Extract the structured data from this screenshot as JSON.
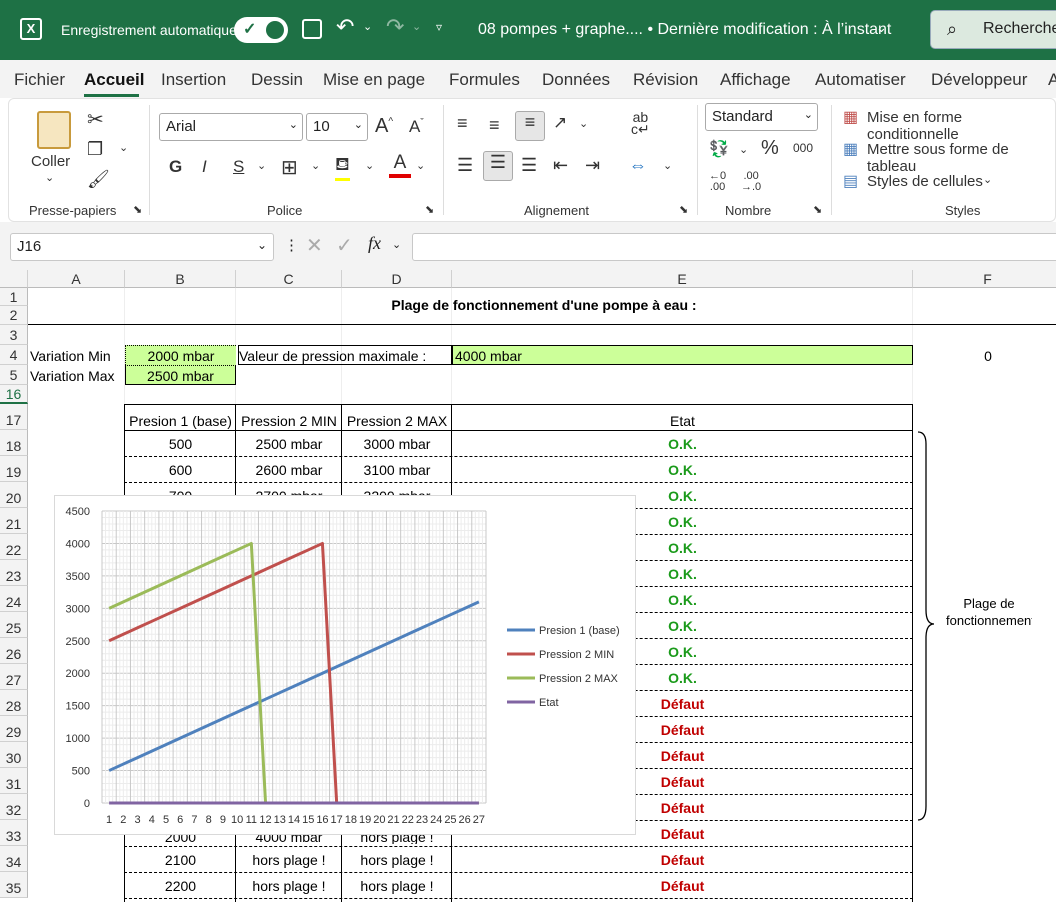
{
  "titlebar": {
    "autosave_label": "Enregistrement automatique",
    "doc_title": "08 pompes + graphe.... • Dernière modification : À l’instant",
    "search_label": "Recherche"
  },
  "menu": [
    "Fichier",
    "Accueil",
    "Insertion",
    "Dessin",
    "Mise en page",
    "Formules",
    "Données",
    "Révision",
    "Affichage",
    "Automatiser",
    "Développeur",
    "A"
  ],
  "ribbon": {
    "clipboard": {
      "paste_label": "Coller",
      "group": "Presse-papiers"
    },
    "font": {
      "name": "Arial",
      "size": "10",
      "bold": "G",
      "italic": "I",
      "underline": "S",
      "group": "Police"
    },
    "alignment": {
      "group": "Alignement"
    },
    "number": {
      "format": "Standard",
      "percent": "%",
      "thousands": "000",
      "group": "Nombre"
    },
    "styles": {
      "conditional": "Mise en forme conditionnelle",
      "table": "Mettre sous forme de tableau",
      "cell_styles": "Styles de cellules",
      "group": "Styles"
    }
  },
  "formula": {
    "name_box": "J16",
    "fx": "fx"
  },
  "columns": [
    "A",
    "B",
    "C",
    "D",
    "E",
    "F"
  ],
  "rows": [
    "1",
    "2",
    "3",
    "4",
    "5",
    "16",
    "17",
    "18",
    "19",
    "20",
    "21",
    "22",
    "23",
    "24",
    "25",
    "26",
    "27",
    "28",
    "29",
    "30",
    "31",
    "32",
    "33",
    "34",
    "35"
  ],
  "sheet": {
    "title": "Plage de fonctionnement d'une pompe à eau :",
    "var_min_label": "Variation Min",
    "var_min_value": "2000 mbar",
    "var_max_label": "Variation Max",
    "var_max_value": "2500 mbar",
    "max_pressure_label": "Valeur de pression maximale :",
    "max_pressure_value": "4000 mbar",
    "f4_value": "0",
    "table_headers": [
      "Presion 1 (base)",
      "Pression 2 MIN",
      "Pression 2 MAX",
      "Etat"
    ],
    "row18": [
      "500",
      "2500 mbar",
      "3000 mbar",
      "O.K."
    ],
    "row19": [
      "600",
      "2600 mbar",
      "3100 mbar",
      "O.K."
    ],
    "row20_partial": [
      "700",
      "2700 mbar",
      "3200 mbar"
    ],
    "row33_partial": [
      "2000",
      "4000 mbar",
      "hors plage !"
    ],
    "row34": [
      "2100",
      "hors plage !",
      "hors plage !",
      "Défaut"
    ],
    "row35": [
      "2200",
      "hors plage !",
      "hors plage !",
      "Défaut"
    ],
    "etat_column": [
      "O.K.",
      "O.K.",
      "O.K.",
      "O.K.",
      "O.K.",
      "O.K.",
      "O.K.",
      "O.K.",
      "O.K.",
      "O.K.",
      "Défaut",
      "Défaut",
      "Défaut",
      "Défaut",
      "Défaut",
      "Défaut",
      "Défaut",
      "Défaut"
    ],
    "bracket_label": "Plage de fonctionnement."
  },
  "colors": {
    "excel_green": "#1e7145",
    "cell_green": "#ccff99",
    "ok_green": "#1a9a1a",
    "defaut_red": "#c00000"
  },
  "chart_data": {
    "type": "line",
    "x": [
      1,
      2,
      3,
      4,
      5,
      6,
      7,
      8,
      9,
      10,
      11,
      12,
      13,
      14,
      15,
      16,
      17,
      18,
      19,
      20,
      21,
      22,
      23,
      24,
      25,
      26,
      27
    ],
    "ylim": [
      0,
      4500
    ],
    "yticks": [
      0,
      500,
      1000,
      1500,
      2000,
      2500,
      3000,
      3500,
      4000,
      4500
    ],
    "grid": true,
    "legend_position": "right",
    "series": [
      {
        "name": "Presion 1 (base)",
        "color": "#4f81bd",
        "values": [
          500,
          600,
          700,
          800,
          900,
          1000,
          1100,
          1200,
          1300,
          1400,
          1500,
          1600,
          1700,
          1800,
          1900,
          2000,
          2100,
          2200,
          2300,
          2400,
          2500,
          2600,
          2700,
          2800,
          2900,
          3000,
          3100
        ]
      },
      {
        "name": "Pression 2 MIN",
        "color": "#c0504d",
        "values": [
          2500,
          2600,
          2700,
          2800,
          2900,
          3000,
          3100,
          3200,
          3300,
          3400,
          3500,
          3600,
          3700,
          3800,
          3900,
          4000,
          0,
          0,
          0,
          0,
          0,
          0,
          0,
          0,
          0,
          0,
          0
        ]
      },
      {
        "name": "Pression 2 MAX",
        "color": "#9bbb59",
        "values": [
          3000,
          3100,
          3200,
          3300,
          3400,
          3500,
          3600,
          3700,
          3800,
          3900,
          4000,
          0,
          0,
          0,
          0,
          0,
          0,
          0,
          0,
          0,
          0,
          0,
          0,
          0,
          0,
          0,
          0
        ]
      },
      {
        "name": "Etat",
        "color": "#8064a2",
        "values": [
          0,
          0,
          0,
          0,
          0,
          0,
          0,
          0,
          0,
          0,
          0,
          0,
          0,
          0,
          0,
          0,
          0,
          0,
          0,
          0,
          0,
          0,
          0,
          0,
          0,
          0,
          0
        ]
      }
    ]
  }
}
